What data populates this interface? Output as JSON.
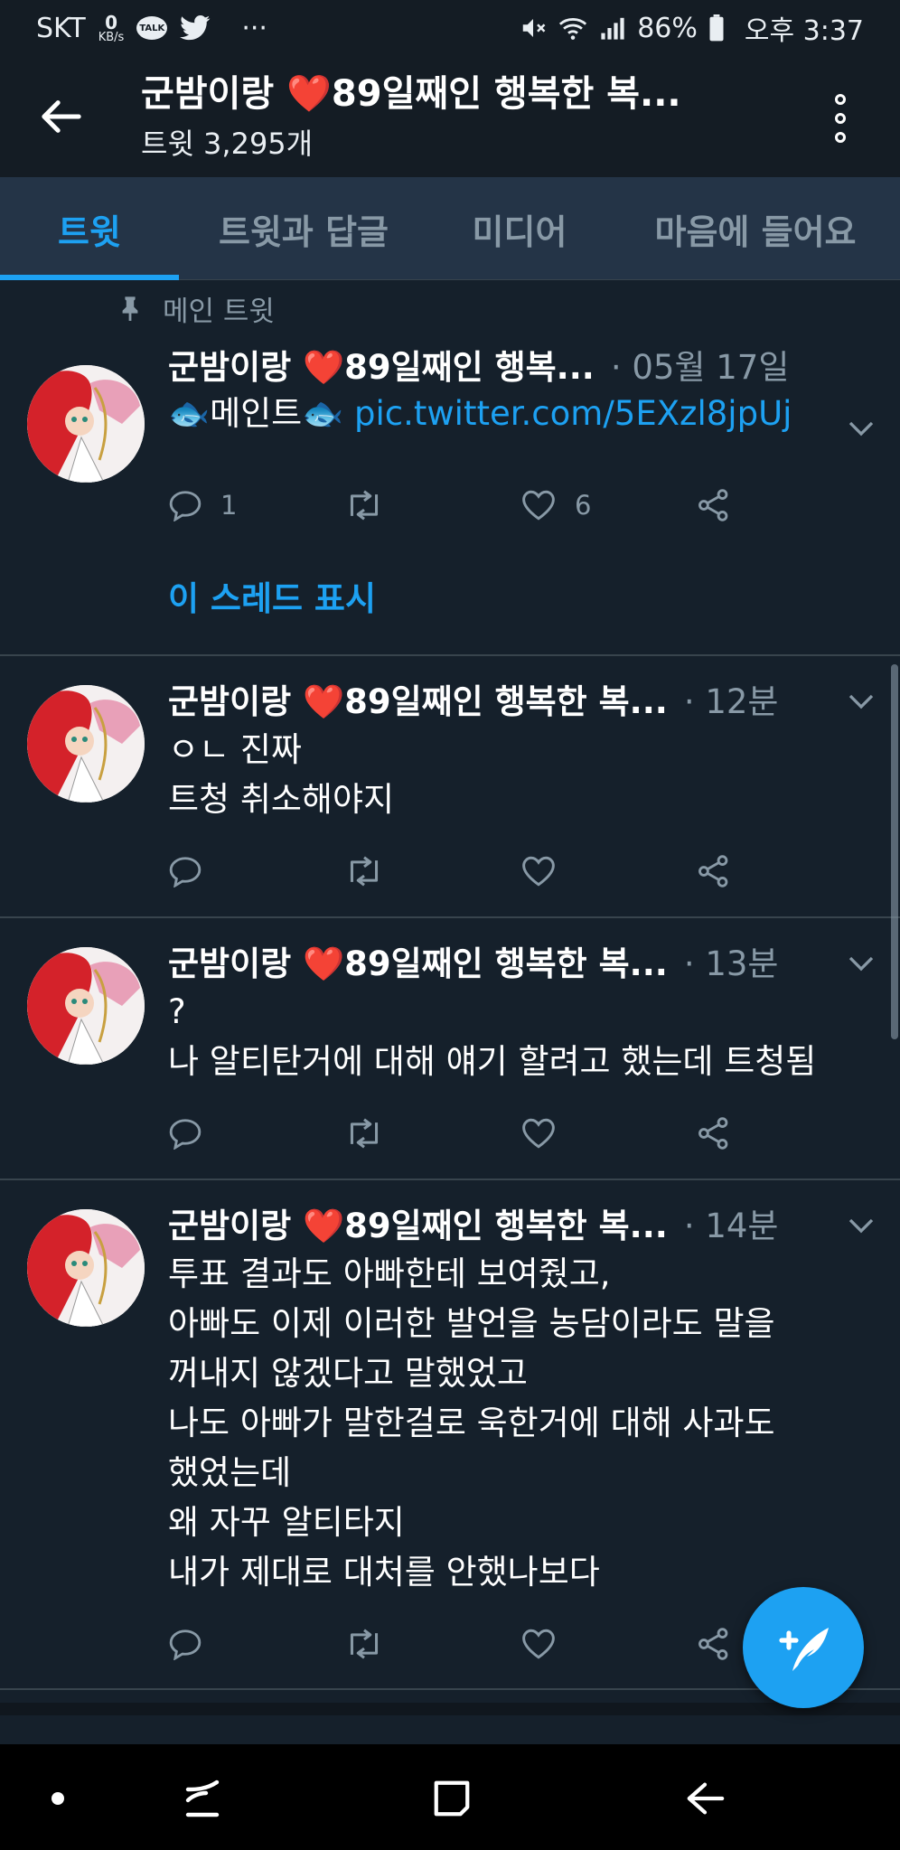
{
  "status_bar": {
    "carrier": "SKT",
    "net_speed": "0",
    "net_unit": "KB/s",
    "talk_badge": "TALK",
    "more": "···",
    "battery": "86%",
    "time": "오후 3:37"
  },
  "header": {
    "title": "군밤이랑 ❤️89일째인 행복한 복...",
    "subtitle": "트윗 3,295개"
  },
  "tabs": [
    {
      "label": "트윗",
      "active": true
    },
    {
      "label": "트윗과 답글",
      "active": false
    },
    {
      "label": "미디어",
      "active": false
    },
    {
      "label": "마음에 들어요",
      "active": false
    }
  ],
  "pinned_label": "메인 트윗",
  "tweets": [
    {
      "name": "군밤이랑 ❤️89일째인 행복...",
      "time": "· 05월 17일",
      "text": "🐟메인트🐟 ",
      "link": "pic.twitter.com/5EXzl8jpUj",
      "reply_count": "1",
      "like_count": "6",
      "thread_link": "이 스레드 표시"
    },
    {
      "name": "군밤이랑 ❤️89일째인 행복한 복...",
      "time": "· 12분",
      "text": "ㅇㄴ 진짜\n트청 취소해야지"
    },
    {
      "name": "군밤이랑 ❤️89일째인 행복한 복...",
      "time": "· 13분",
      "text": "?\n나 알티탄거에 대해 얘기 할려고 했는데 트청됨"
    },
    {
      "name": "군밤이랑 ❤️89일째인 행복한 복...",
      "time": "· 14분",
      "text": "투표 결과도 아빠한테 보여줬고,\n아빠도 이제 이러한 발언을 농담이라도 말을\n꺼내지 않겠다고 말했었고\n나도 아빠가 말한걸로 욱한거에 대해 사과도\n했었는데\n왜 자꾸 알티타지\n내가 제대로 대처를 안했나보다"
    }
  ],
  "colors": {
    "background": "#15202b",
    "accent": "#1da1f2",
    "muted": "#8899a6",
    "divider": "#38444d"
  }
}
